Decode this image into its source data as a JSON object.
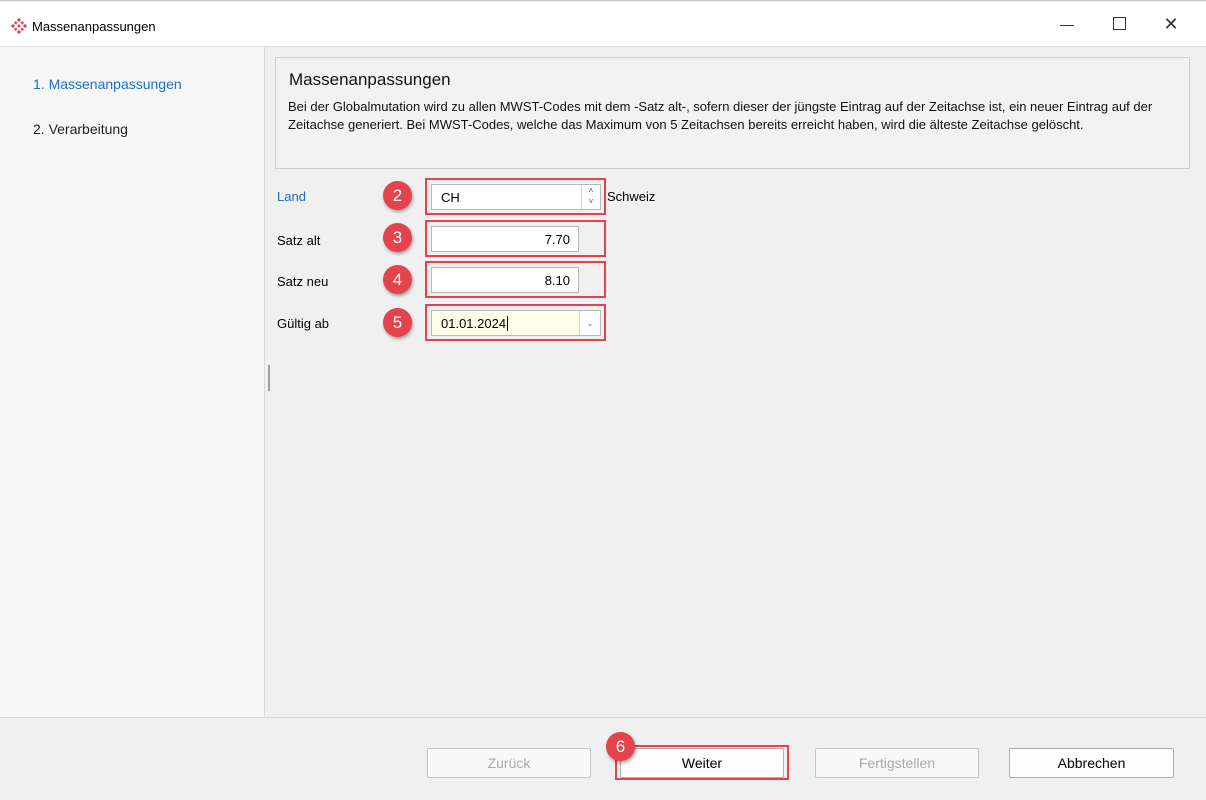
{
  "window": {
    "title": "Massenanpassungen",
    "controls": {
      "minimize": "—",
      "maximize": "☐",
      "close": "✕"
    }
  },
  "nav": {
    "items": [
      {
        "label": "1. Massenanpassungen",
        "active": true
      },
      {
        "label": "2. Verarbeitung",
        "active": false
      }
    ]
  },
  "info": {
    "title": "Massenanpassungen",
    "description": "Bei der Globalmutation wird zu allen MWST-Codes mit dem -Satz alt-, sofern dieser der jüngste Eintrag auf der Zeitachse ist, ein neuer Eintrag auf der Zeitachse generiert. Bei MWST-Codes, welche das Maximum von 5 Zeitachsen bereits erreicht haben, wird die älteste Zeitachse gelöscht."
  },
  "form": {
    "land_label": "Land",
    "land_value": "CH",
    "land_name": "Schweiz",
    "satz_alt_label": "Satz alt",
    "satz_alt_value": "7.70",
    "satz_neu_label": "Satz neu",
    "satz_neu_value": "8.10",
    "gueltig_ab_label": "Gültig ab",
    "gueltig_ab_value": "01.01.2024"
  },
  "annotations": {
    "b2": "2",
    "b3": "3",
    "b4": "4",
    "b5": "5",
    "b6": "6"
  },
  "buttons": {
    "back": "Zurück",
    "next": "Weiter",
    "finish": "Fertigstellen",
    "cancel": "Abbrechen"
  },
  "colors": {
    "accent": "#1c6fc1",
    "annotation": "#e2434c",
    "date_field_bg": "#fefee8"
  },
  "icons": {
    "app": "app-logo-icon",
    "spin": "spin-updown-icon",
    "dropdown": "chevron-down-icon"
  }
}
